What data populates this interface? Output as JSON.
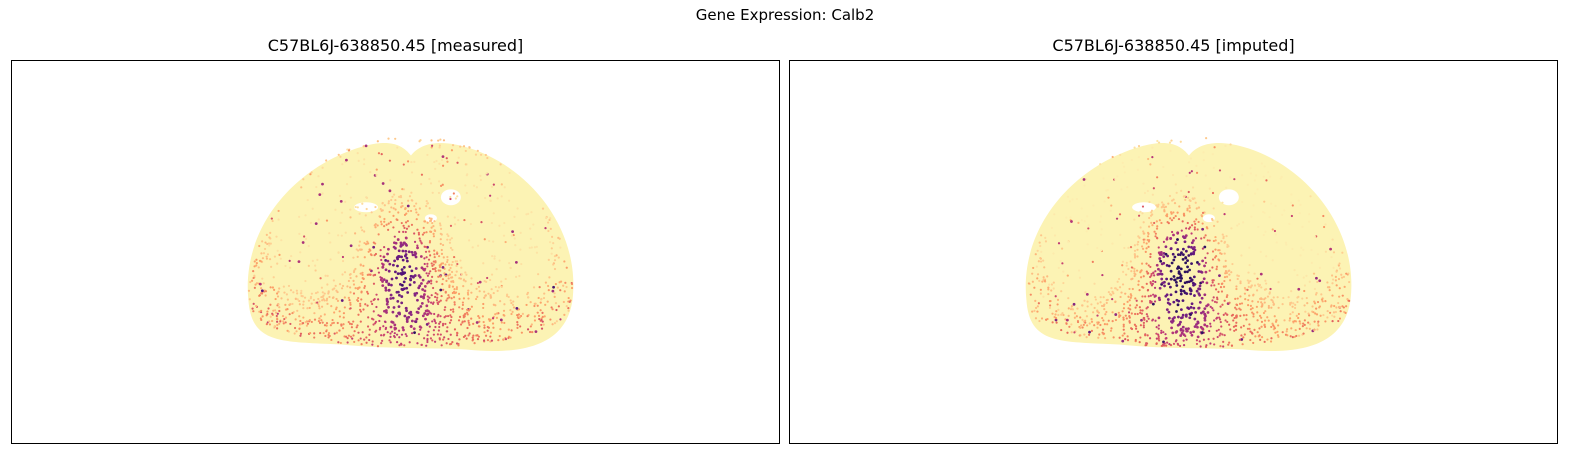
{
  "figure": {
    "suptitle": "Gene Expression: Calb2"
  },
  "colors": {
    "background": "#ffffff",
    "tissue_base": "#fcf3b4",
    "colormap": [
      "#fcfdbf",
      "#fecf92",
      "#fc9f67",
      "#e8685b",
      "#c03a76",
      "#8c2981",
      "#5a167e",
      "#2b115e"
    ]
  },
  "chart_data": [
    {
      "type": "scatter",
      "title": "C57BL6J-638850.45 [measured]",
      "gene": "Calb2",
      "colormap": "magma_r",
      "axes_ticks": "none",
      "grid": false,
      "expression_pattern": {
        "background_level": 0.08,
        "cortex_level": 0.35,
        "medial_high_level": 0.75,
        "ventral_level": 0.45
      }
    },
    {
      "type": "scatter",
      "title": "C57BL6J-638850.45 [imputed]",
      "gene": "Calb2",
      "colormap": "magma_r",
      "axes_ticks": "none",
      "grid": false,
      "expression_pattern": {
        "background_level": 0.05,
        "cortex_level": 0.3,
        "medial_high_level": 0.95,
        "ventral_level": 0.5
      }
    }
  ]
}
